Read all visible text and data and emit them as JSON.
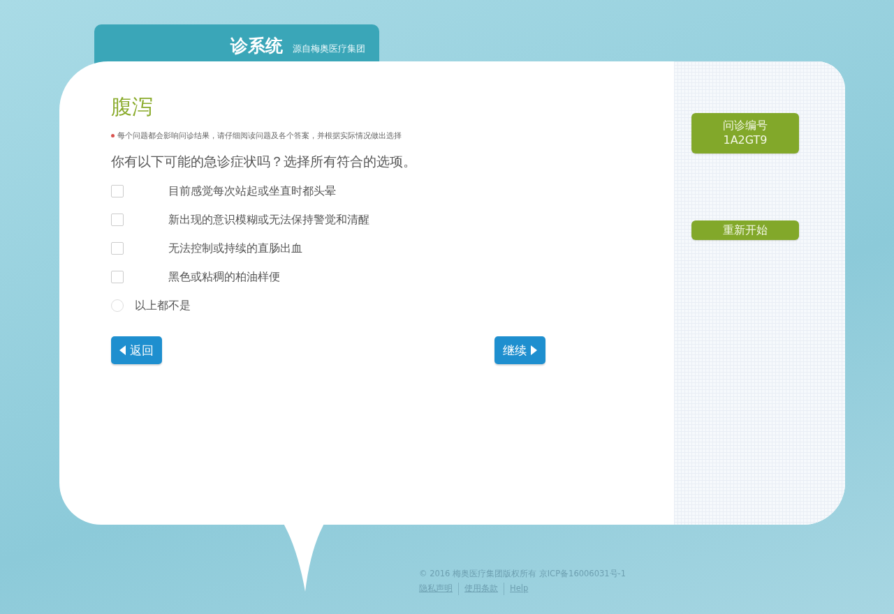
{
  "header": {
    "title": "诊系统",
    "subtitle": "源自梅奥医疗集团"
  },
  "question": {
    "topic": "腹泻",
    "note": "每个问题都会影响问诊结果，请仔细阅读问题及各个答案，并根据实际情况做出选择",
    "prompt": "你有以下可能的急诊症状吗？选择所有符合的选项。",
    "options": [
      {
        "kind": "checkbox",
        "label": "目前感觉每次站起或坐直时都头晕",
        "checked": false
      },
      {
        "kind": "checkbox",
        "label": "新出现的意识模糊或无法保持警觉和清醒",
        "checked": false
      },
      {
        "kind": "checkbox",
        "label": "无法控制或持续的直肠出血",
        "checked": false
      },
      {
        "kind": "checkbox",
        "label": "黑色或粘稠的柏油样便",
        "checked": false
      },
      {
        "kind": "radio",
        "label": "以上都不是",
        "checked": false
      }
    ]
  },
  "nav": {
    "back": "返回",
    "next": "继续"
  },
  "sidebar": {
    "code_label": "问诊编号",
    "code": "1A2GT9",
    "restart": "重新开始"
  },
  "footer": {
    "copyright": "© 2016 梅奥医疗集团版权所有 京ICP备16006031号-1",
    "links": [
      "隐私声明",
      "使用条款",
      "Help"
    ]
  }
}
